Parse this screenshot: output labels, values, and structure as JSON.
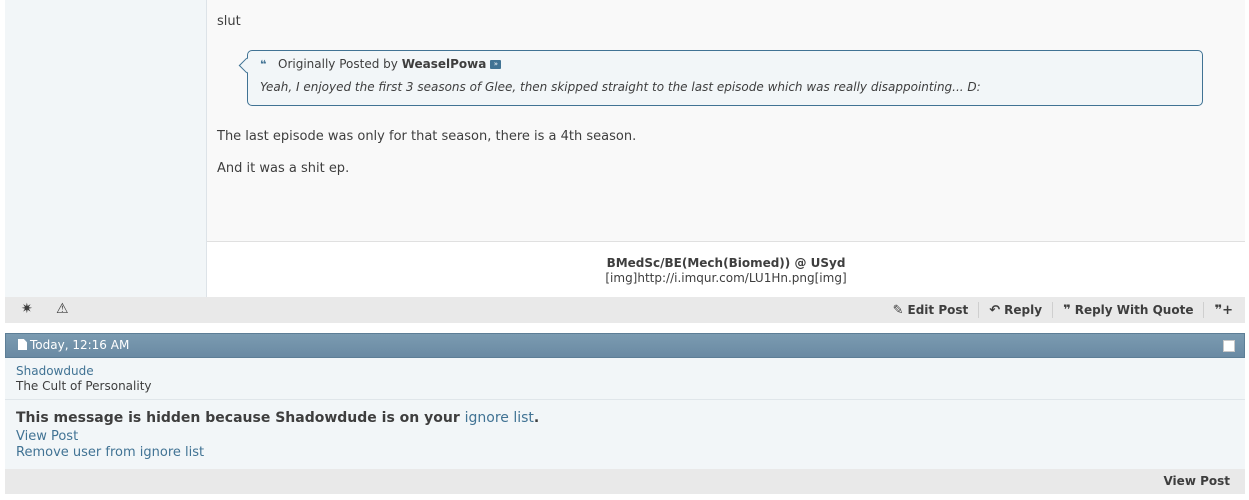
{
  "post1": {
    "message_first_line": "slut",
    "quote": {
      "prefix": "Originally Posted by",
      "author": "WeaselPowa",
      "text": "Yeah, I enjoyed the first 3 seasons of Glee, then skipped straight to the last episode which was really disappointing... D:"
    },
    "message_paragraph1": "The last episode was only for that season, there is a 4th season.",
    "message_paragraph2": "And it was a shit ep.",
    "signature": {
      "line1": "BMedSc/BE(Mech(Biomed)) @ USyd",
      "line2": "[img]http://i.imqur.com/LU1Hn.png[img]"
    },
    "footer": {
      "edit_label": "Edit Post",
      "reply_label": "Reply",
      "reply_quote_label": "Reply With Quote"
    }
  },
  "post2": {
    "date": "Today, 12:16 AM",
    "username": "Shadowdude",
    "user_title": "The Cult of Personality",
    "hidden_message_prefix": "This message is hidden because Shadowdude is on your",
    "ignore_list_link": "ignore list",
    "hidden_message_suffix": ".",
    "view_post_link": "View Post",
    "remove_link": "Remove user from ignore list",
    "footer_view_post": "View Post"
  },
  "colors": {
    "link": "#417394",
    "header_bar": "#6a8aa3",
    "panel_bg": "#f2f6f8",
    "footer_bg": "#e9e9e9"
  },
  "icons": [
    "quote-icon",
    "view-post-icon",
    "reputation-icon",
    "report-icon",
    "edit-icon",
    "reply-icon",
    "reply-quote-icon",
    "multiquote-icon",
    "document-icon",
    "checkbox-icon"
  ]
}
